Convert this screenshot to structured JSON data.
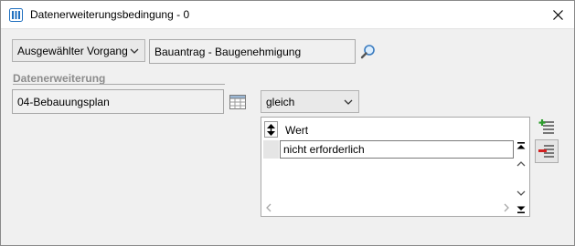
{
  "window": {
    "title": "Datenerweiterungsbedingung - 0"
  },
  "header": {
    "scope_select": "Ausgewählter Vorgang",
    "process_value": "Bauantrag - Baugenehmigung"
  },
  "datenerweiterung": {
    "section_label": "Datenerweiterung",
    "field_value": "04-Bebauungsplan",
    "operator_select": "gleich"
  },
  "values_grid": {
    "column_header": "Wert",
    "rows": [
      "nicht erforderlich"
    ]
  },
  "colors": {
    "accent_blue": "#1f6fbf",
    "add_green": "#2e9e2e",
    "remove_red": "#d21f1f"
  }
}
